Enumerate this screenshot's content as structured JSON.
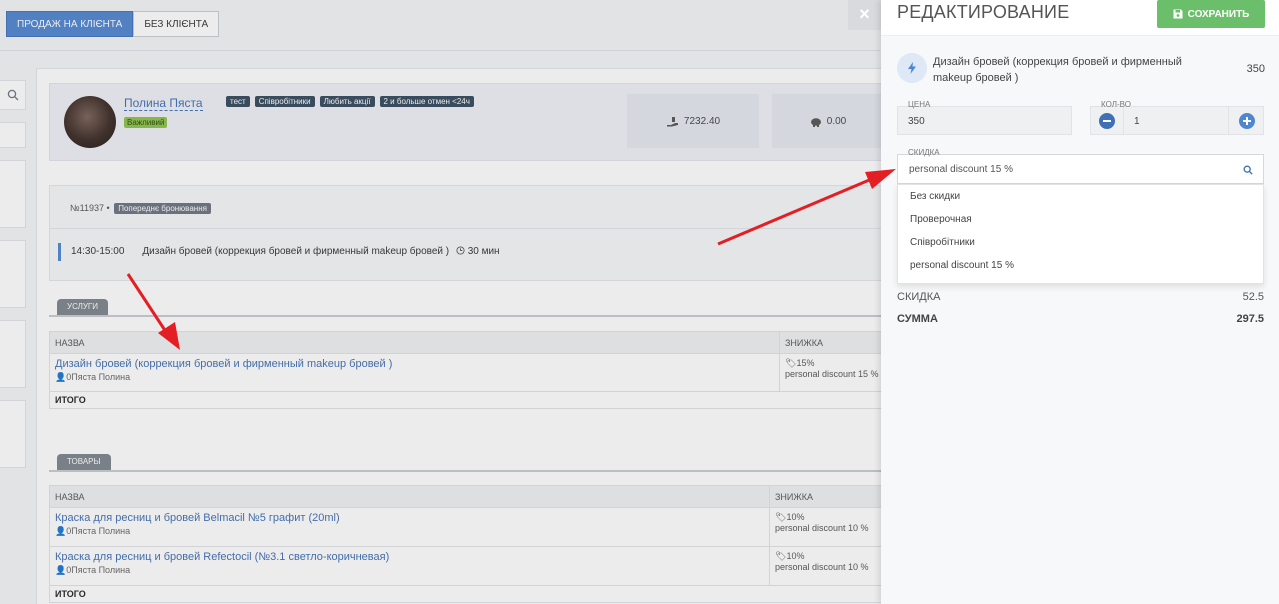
{
  "top_tabs": {
    "with_client": "ПРОДАЖ НА КЛІЄНТА",
    "without_client": "БЕЗ КЛІЄНТА"
  },
  "client": {
    "name": "Полина Пяста",
    "badge": "Важливий",
    "tags": [
      "тест",
      "Співробітники",
      "Любить акції",
      "2 и больше отмен <24ч"
    ],
    "stats": [
      "7232.40",
      "0.00"
    ]
  },
  "booking": {
    "number": "№11937 •",
    "status": "Попереднє бронювання",
    "time": "14:30-15:00",
    "service": "Дизайн бровей (коррекция бровей и фирменный makeup бровей )",
    "duration": "30 мин"
  },
  "services_section": {
    "tab": "УСЛУГИ",
    "headers": {
      "name": "НАЗВА",
      "discount": "ЗНИЖКА"
    },
    "rows": [
      {
        "name": "Дизайн бровей (коррекция бровей и фирменный makeup бровей )",
        "who": "0Пяста Полина",
        "discount_pct": "15%",
        "discount_name": "personal discount 15 %"
      }
    ],
    "total_label": "ИТОГО"
  },
  "goods_section": {
    "tab": "ТОВАРЫ",
    "headers": {
      "name": "НАЗВА",
      "discount": "ЗНИЖКА"
    },
    "rows": [
      {
        "name": "Краска для ресниц и бровей Belmacil №5 графит (20ml)",
        "who": "0Пяста Полина",
        "discount_pct": "10%",
        "discount_name": "personal discount 10 %"
      },
      {
        "name": "Краска для ресниц и бровей Refectocil (№3.1 светло-коричневая)",
        "who": "0Пяста Полина",
        "discount_pct": "10%",
        "discount_name": "personal discount 10 %"
      }
    ],
    "total_label": "ИТОГО"
  },
  "panel": {
    "close": "×",
    "title": "РЕДАКТИРОВАНИЕ",
    "save_label": "СОХРАНИТЬ",
    "service_name": "Дизайн бровей (коррекция бровей и фирменный makeup бровей )",
    "service_price": "350",
    "price_label": "ЦЕНА",
    "price_value": "350",
    "qty_label": "КОЛ-ВО",
    "qty_value": "1",
    "discount_label": "СКИДКА",
    "discount_value": "personal discount 15 %",
    "discount_options": [
      "Без скидки",
      "Проверочная",
      "Співробітники",
      "personal discount 15 %"
    ],
    "summary": {
      "discount_label": "СКИДКА",
      "discount_value": "52.5",
      "total_label": "СУММА",
      "total_value": "297.5"
    }
  },
  "colors": {
    "accent": "#4f86d0",
    "save": "#6cbf6a",
    "arrow": "#e31e24"
  }
}
